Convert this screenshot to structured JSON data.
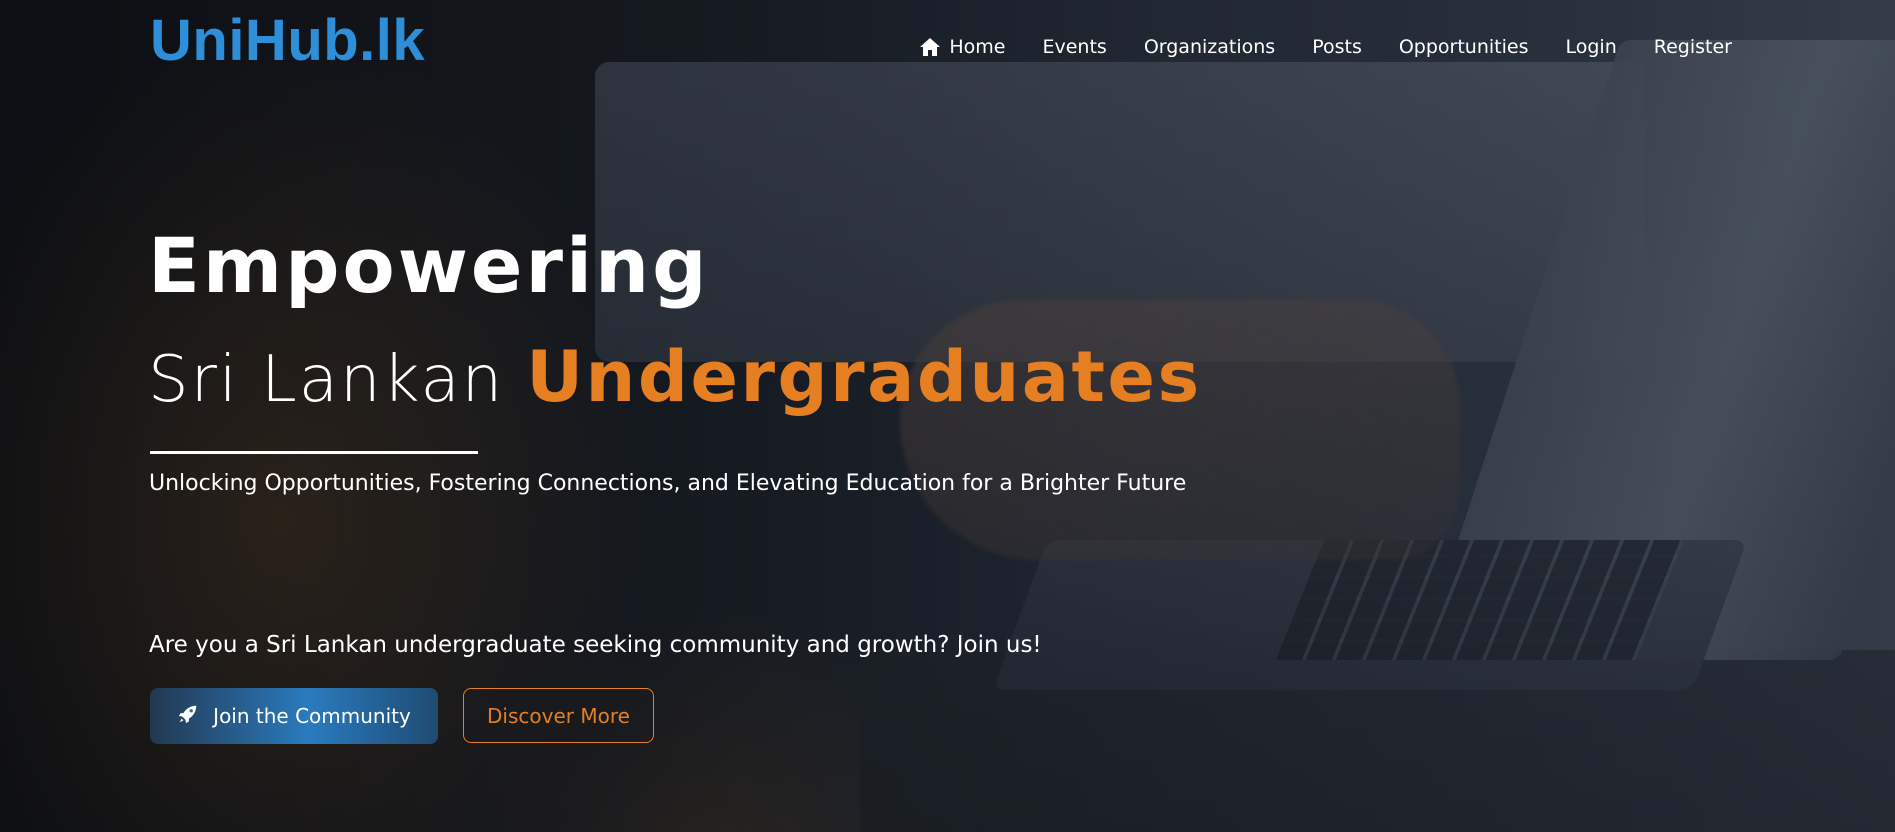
{
  "brand": {
    "logo_text": "UniHub.lk",
    "logo_color": "#2f8ed8"
  },
  "nav": {
    "items": [
      {
        "label": "Home",
        "icon": "home-icon"
      },
      {
        "label": "Events"
      },
      {
        "label": "Organizations"
      },
      {
        "label": "Posts"
      },
      {
        "label": "Opportunities"
      },
      {
        "label": "Login"
      },
      {
        "label": "Register"
      }
    ]
  },
  "hero": {
    "headline": "Empowering",
    "subline_light": "Sri Lankan",
    "subline_accent": "Undergraduates",
    "tagline": "Unlocking Opportunities, Fostering Connections, and Elevating Education for a Brighter Future",
    "prompt": "Are you a Sri Lankan undergraduate seeking community and growth? Join us!",
    "primary_button": {
      "label": "Join the Community",
      "icon": "rocket-icon"
    },
    "secondary_button": {
      "label": "Discover More"
    }
  },
  "colors": {
    "accent": "#e67e22",
    "primary": "#2a7bbf",
    "text": "#ffffff"
  }
}
